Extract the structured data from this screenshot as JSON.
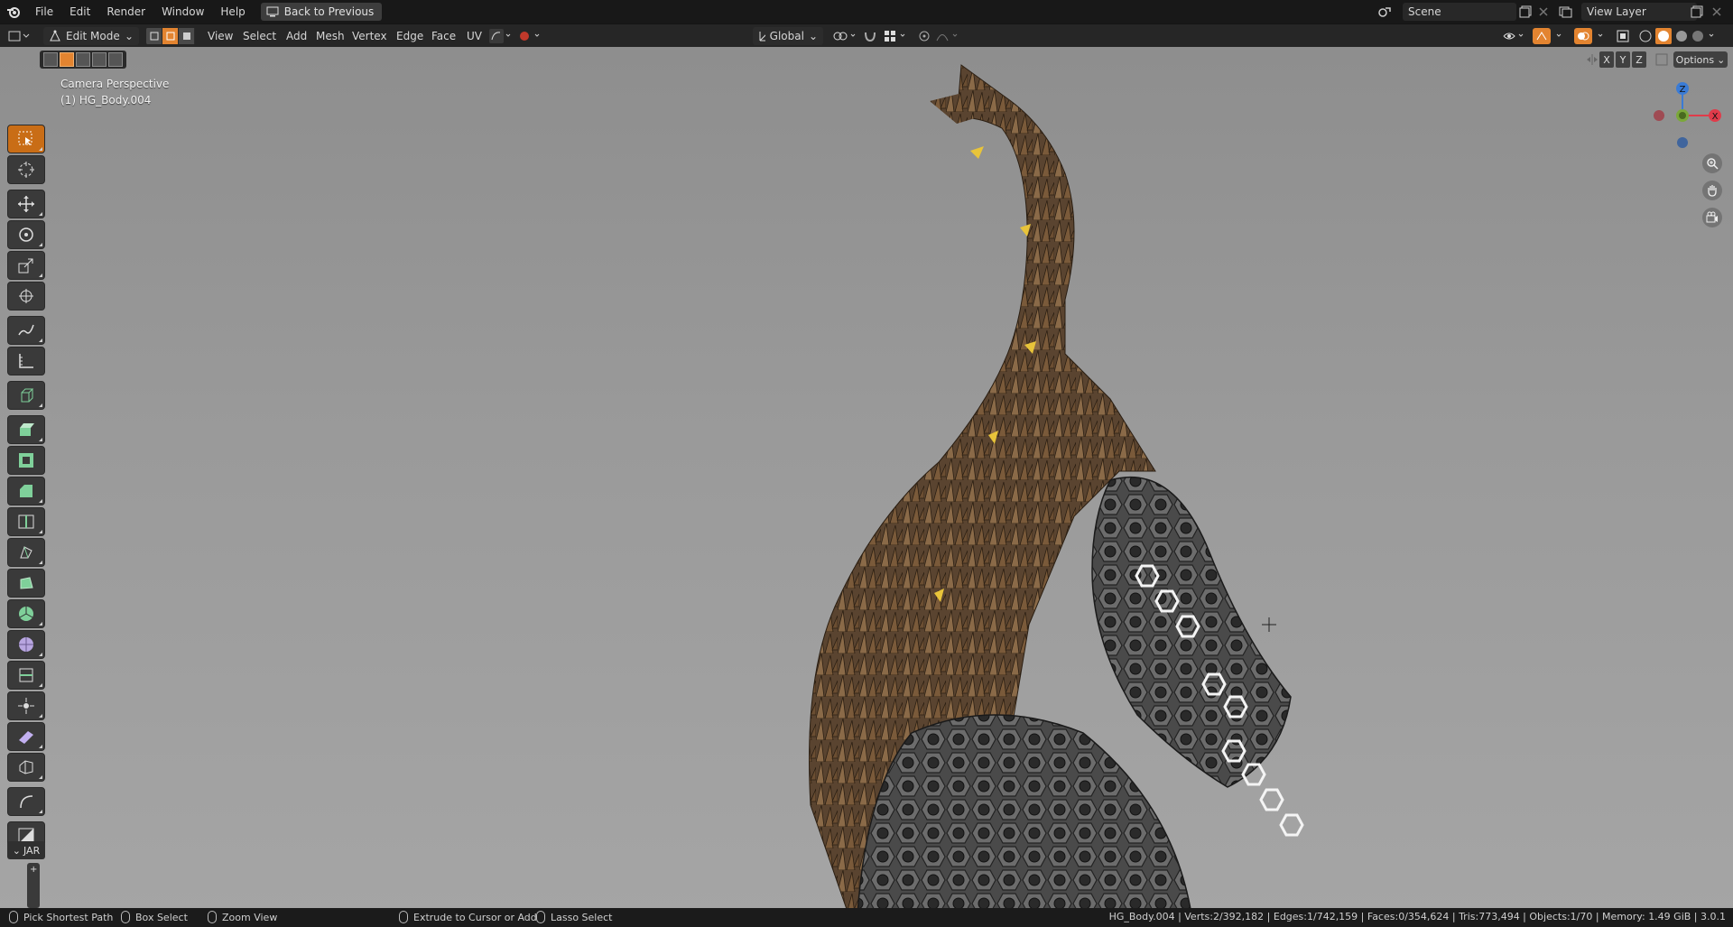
{
  "topbar": {
    "menu": [
      "File",
      "Edit",
      "Render",
      "Window",
      "Help"
    ],
    "back_button": "Back to Previous",
    "scene": "Scene",
    "view_layer": "View Layer"
  },
  "header": {
    "mode": "Edit Mode",
    "menus": [
      "View",
      "Select",
      "Add",
      "Mesh",
      "Vertex",
      "Edge",
      "Face",
      "UV"
    ],
    "transform_orientation": "Global",
    "options": "Options",
    "axes": [
      "X",
      "Y",
      "Z"
    ]
  },
  "viewport": {
    "view_name": "Camera Perspective",
    "object_name": "(1) HG_Body.004",
    "gizmo_axes": {
      "z": "Z",
      "x": "X"
    }
  },
  "toolbar": {
    "tools": [
      "select-box",
      "cursor",
      "move",
      "rotate",
      "scale",
      "transform",
      "annotate",
      "measure",
      "add-cube",
      "extrude-region",
      "inset-faces",
      "bevel",
      "loop-cut",
      "knife",
      "poly-build",
      "spin",
      "smooth",
      "edge-slide",
      "shrink-fatten",
      "shear",
      "rip-region"
    ],
    "active_tool": "select-box",
    "jar_tab": "JAR"
  },
  "statusbar": {
    "left": [
      {
        "label": "Pick Shortest Path"
      },
      {
        "label": "Box Select"
      },
      {
        "label": "Zoom View"
      },
      {
        "label": "Extrude to Cursor or Add"
      },
      {
        "label": "Lasso Select"
      }
    ],
    "stats": "HG_Body.004 | Verts:2/392,182 | Edges:1/742,159 | Faces:0/354,624 | Tris:773,494 | Objects:1/70 | Memory: 1.49 GiB | 3.0.1"
  },
  "colors": {
    "accent": "#e38430",
    "viewport_top": "#8e8e8e",
    "viewport_bottom": "#a5a5a5",
    "spikes": "#7a5a3a",
    "mesh": "#3a3a3a",
    "gizmo_x": "#e03b4a",
    "gizmo_y": "#7ba83a",
    "gizmo_z": "#3a7bd5"
  }
}
